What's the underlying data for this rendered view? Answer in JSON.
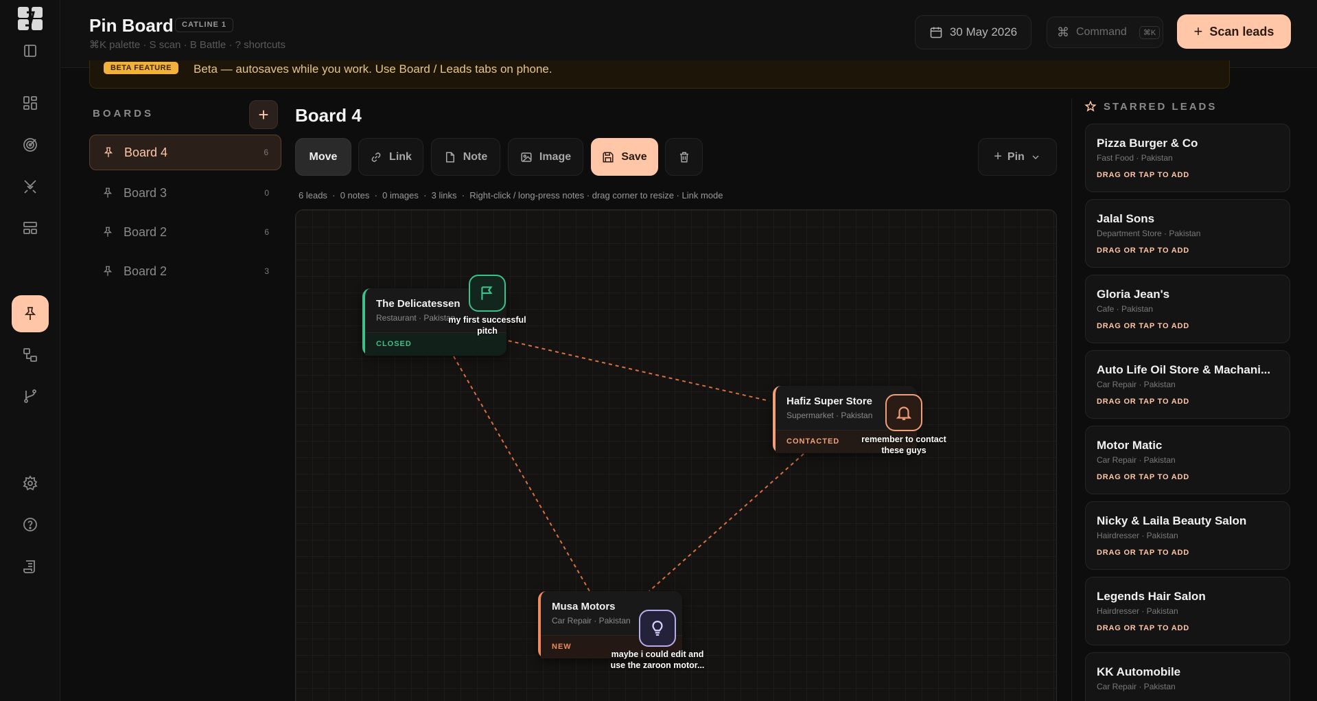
{
  "header": {
    "title": "Pin Board",
    "badge": "CATLINE 1",
    "subtitle": "⌘K palette · S scan · B Battle · ? shortcuts",
    "date": "30 May 2026",
    "command_label": "Command",
    "command_kbd": "⌘K",
    "scan_label": "Scan leads"
  },
  "banner": {
    "tag": "BETA FEATURE",
    "text": "Beta — autosaves while you work. Use Board / Leads tabs on phone."
  },
  "boards": {
    "label": "BOARDS",
    "items": [
      {
        "label": "Board 4",
        "count": "6"
      },
      {
        "label": "Board 3",
        "count": "0"
      },
      {
        "label": "Board 2",
        "count": "6"
      },
      {
        "label": "Board 2",
        "count": "3"
      }
    ]
  },
  "main": {
    "title": "Board 4",
    "tools": {
      "move": "Move",
      "link": "Link",
      "note": "Note",
      "image": "Image",
      "save": "Save",
      "pin": "Pin"
    },
    "stats": "6 leads  ·  0 notes  ·  0 images  ·  3 links  ·  Right-click / long-press notes · drag corner to resize · Link mode"
  },
  "canvas_cards": [
    {
      "name": "The Delicatessen",
      "meta": "Restaurant · Pakistan",
      "status": "CLOSED",
      "note": "my first successful pitch",
      "icon": "flag-icon"
    },
    {
      "name": "Hafiz Super Store",
      "meta": "Supermarket · Pakistan",
      "status": "CONTACTED",
      "note": "remember to contact these guys",
      "icon": "bell-icon"
    },
    {
      "name": "Musa Motors",
      "meta": "Car Repair · Pakistan",
      "status": "NEW",
      "note": "maybe i could edit and use the zaroon motor...",
      "icon": "lightbulb-icon"
    }
  ],
  "starred": {
    "label": "STARRED LEADS",
    "cta": "DRAG OR TAP TO ADD",
    "items": [
      {
        "name": "Pizza Burger & Co",
        "meta": "Fast Food · Pakistan"
      },
      {
        "name": "Jalal Sons",
        "meta": "Department Store · Pakistan"
      },
      {
        "name": "Gloria Jean's",
        "meta": "Cafe · Pakistan"
      },
      {
        "name": "Auto Life Oil Store & Machani...",
        "meta": "Car Repair · Pakistan"
      },
      {
        "name": "Motor Matic",
        "meta": "Car Repair · Pakistan"
      },
      {
        "name": "Nicky & Laila Beauty Salon",
        "meta": "Hairdresser · Pakistan"
      },
      {
        "name": "Legends Hair Salon",
        "meta": "Hairdresser · Pakistan"
      },
      {
        "name": "KK Automobile",
        "meta": "Car Repair · Pakistan"
      }
    ]
  },
  "colors": {
    "accent": "#ffc6a8",
    "closed": "#3ec08a",
    "contacted": "#f2a07a",
    "new": "#ef8a5c",
    "banner": "#f2b13a"
  }
}
